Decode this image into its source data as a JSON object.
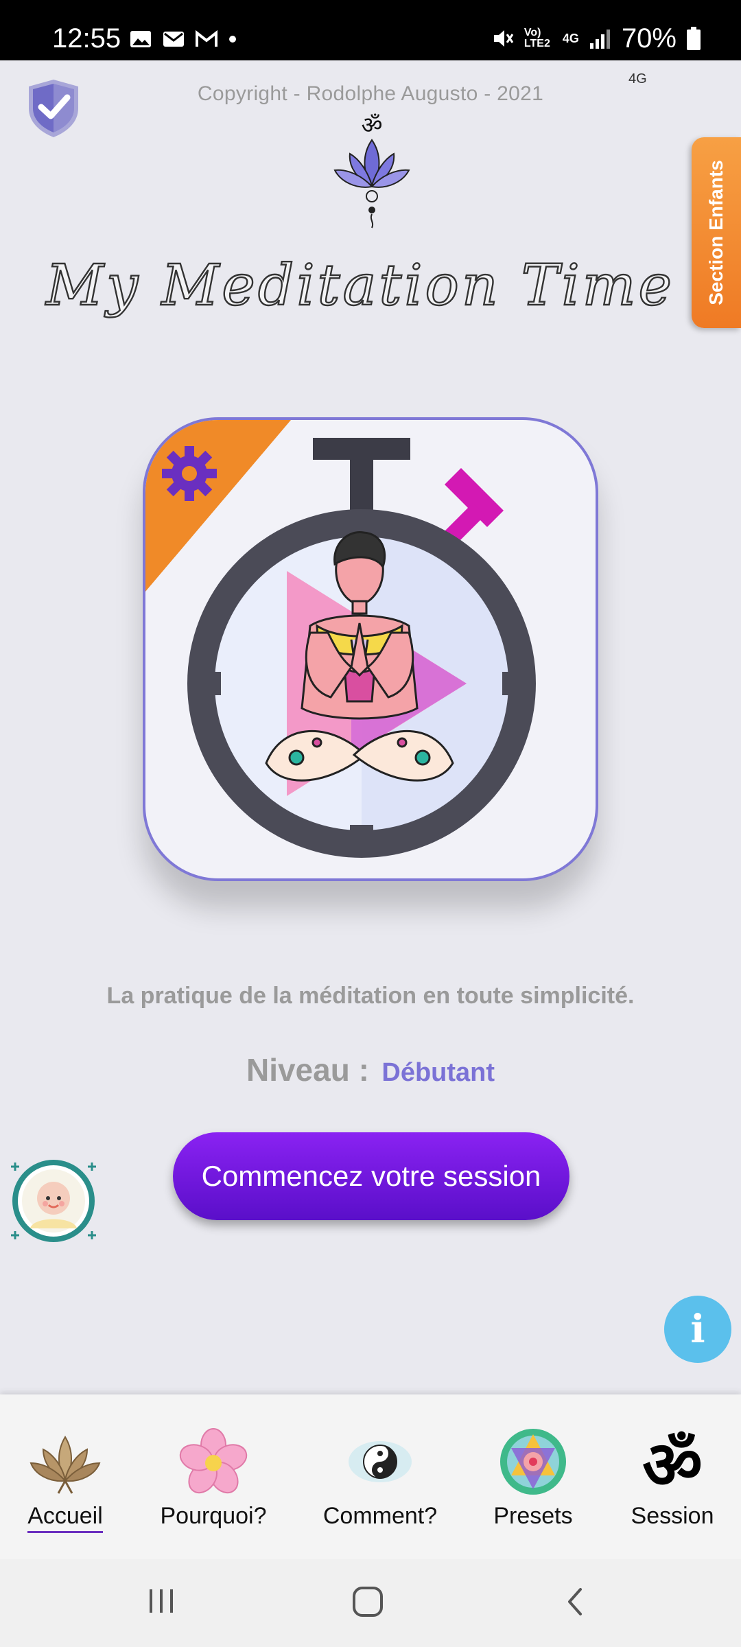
{
  "status_bar": {
    "time": "12:55",
    "network_lte": "Vo) LTE2",
    "network_4g": "4G",
    "battery": "70%",
    "small_network": "4G"
  },
  "header": {
    "copyright": "Copyright - Rodolphe Augusto - 2021",
    "app_title": "My Meditation Time"
  },
  "side_tab": {
    "label": "Section Enfants"
  },
  "main": {
    "tagline": "La pratique de la méditation en toute simplicité.",
    "level_label": "Niveau :",
    "level_value": "Débutant",
    "start_button": "Commencez votre session"
  },
  "bottom_nav": {
    "items": [
      {
        "label": "Accueil",
        "icon": "lotus-icon",
        "active": true
      },
      {
        "label": "Pourquoi?",
        "icon": "flower-icon"
      },
      {
        "label": "Comment?",
        "icon": "yin-yang-icon"
      },
      {
        "label": "Presets",
        "icon": "mandala-icon"
      },
      {
        "label": "Session",
        "icon": "om-icon"
      }
    ]
  },
  "colors": {
    "accent_purple": "#6f1fe0",
    "level_color": "#7b72d6",
    "side_tab_orange": "#f28a2e",
    "info_blue": "#5bc0ec"
  }
}
